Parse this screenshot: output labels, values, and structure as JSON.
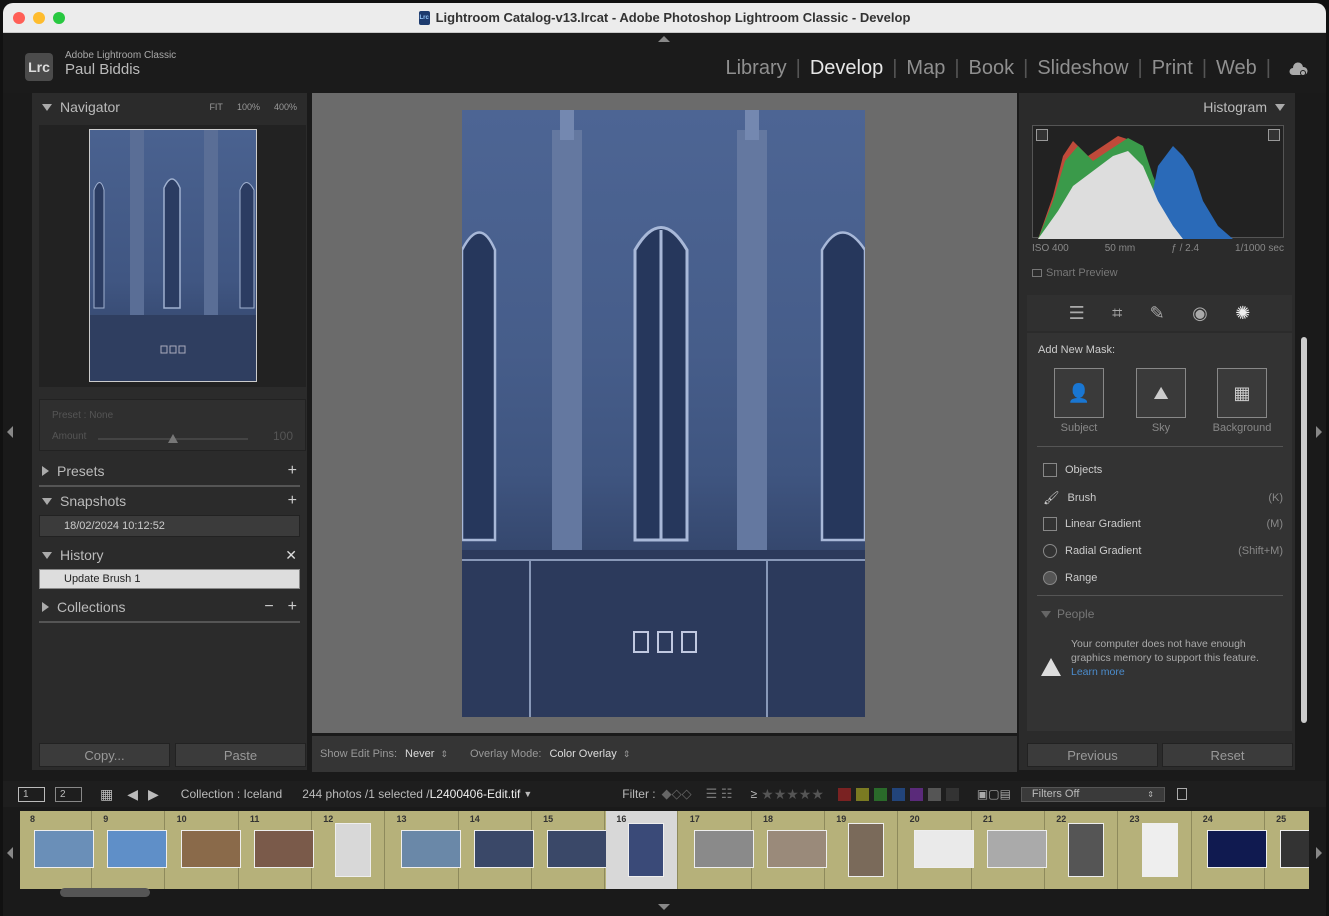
{
  "window": {
    "title": "Lightroom Catalog-v13.lrcat - Adobe Photoshop Lightroom Classic - Develop",
    "colors": {
      "close": "#ff5f57",
      "minimize": "#febc2e",
      "maximize": "#28c840"
    }
  },
  "identity": {
    "logo": "Lrc",
    "app_name": "Adobe Lightroom Classic",
    "user": "Paul Biddis"
  },
  "modules": [
    "Library",
    "Develop",
    "Map",
    "Book",
    "Slideshow",
    "Print",
    "Web"
  ],
  "active_module": "Develop",
  "left": {
    "navigator": {
      "title": "Navigator",
      "fit": "FIT",
      "z100": "100%",
      "z400": "400%"
    },
    "preset": {
      "label": "Preset : None",
      "amount_label": "Amount",
      "amount_value": "100",
      "amount_fraction": 0.5
    },
    "presets": {
      "title": "Presets"
    },
    "snapshots": {
      "title": "Snapshots",
      "item": "18/02/2024 10:12:52"
    },
    "history": {
      "title": "History",
      "item": "Update Brush 1"
    },
    "collections": {
      "title": "Collections"
    },
    "copy": "Copy...",
    "paste": "Paste"
  },
  "toolbar": {
    "edit_pins_label": "Show Edit Pins:",
    "edit_pins_value": "Never",
    "overlay_label": "Overlay Mode:",
    "overlay_value": "Color Overlay"
  },
  "right": {
    "histogram": {
      "title": "Histogram",
      "iso": "ISO 400",
      "focal": "50 mm",
      "aperture": "ƒ / 2.4",
      "shutter": "1/1000 sec",
      "smart_preview": "Smart Preview"
    },
    "mask": {
      "add_new": "Add New Mask:",
      "subject": "Subject",
      "sky": "Sky",
      "background": "Background",
      "objects": "Objects",
      "brush": "Brush",
      "brush_key": "(K)",
      "linear": "Linear Gradient",
      "linear_key": "(M)",
      "radial": "Radial Gradient",
      "radial_key": "(Shift+M)",
      "range": "Range",
      "people": "People",
      "warning": "Your computer does not have enough graphics memory to support this feature.",
      "learn_more": "Learn more"
    },
    "previous": "Previous",
    "reset": "Reset"
  },
  "filmbar": {
    "screen1": "1",
    "screen2": "2",
    "collection": "Collection : Iceland",
    "count": "244 photos /1 selected /",
    "filename": "L2400406-Edit.tif",
    "filter_label": "Filter :",
    "rating_op": "≥",
    "filters_off": "Filters Off",
    "label_colors": [
      "#7a2222",
      "#7a7a22",
      "#2a6a2a",
      "#22447a",
      "#5a2a7a",
      "#555",
      "#333"
    ]
  },
  "filmstrip": {
    "frames": [
      "8",
      "9",
      "10",
      "11",
      "12",
      "13",
      "14",
      "15",
      "16",
      "17",
      "18",
      "19",
      "20",
      "21",
      "22",
      "23",
      "24",
      "25"
    ],
    "selected": "16"
  }
}
